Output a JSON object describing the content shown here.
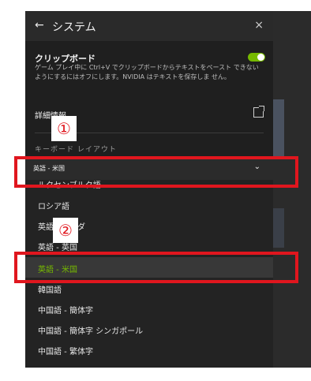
{
  "header": {
    "back_icon": "←",
    "title": "システム",
    "close_icon": "×"
  },
  "clipboard": {
    "label": "クリップボード",
    "description": "ゲーム プレイ中に Ctrl+V でクリップボードからテキストをペースト できないようにするにはオフにします。NVIDIA はテキストを保存しま せん。",
    "toggle_on": true
  },
  "details": {
    "label": "詳細情報"
  },
  "keyboard": {
    "label": "キーボード レイアウト",
    "selected": "英語 - 米国",
    "options": [
      "ルクセンブルク語",
      "ロシア語",
      "英語 - カナダ",
      "英語 - 英国",
      "英語 - 米国",
      "韓国語",
      "中国語 - 簡体字",
      "中国語 - 簡体字 シンガポール",
      "中国語 - 繁体字"
    ]
  },
  "annotations": {
    "badge1": "①",
    "badge2": "②"
  },
  "colors": {
    "accent": "#76b900",
    "highlight": "#e0161e"
  }
}
